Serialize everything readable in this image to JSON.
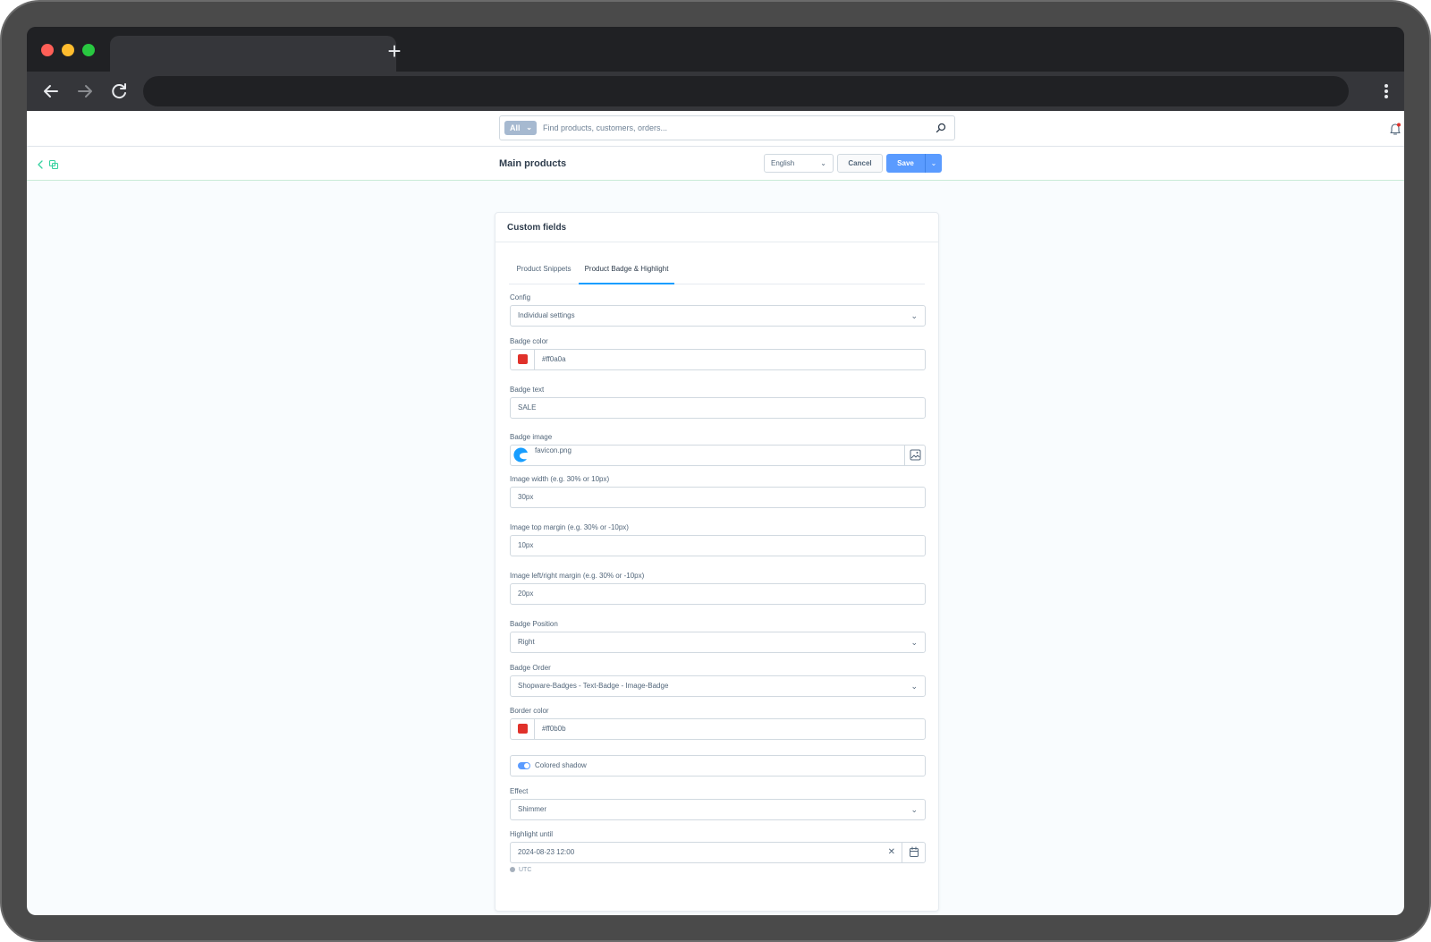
{
  "browser": {
    "new_tab_label": "+"
  },
  "search": {
    "type_label": "All",
    "placeholder": "Find products, customers, orders..."
  },
  "smartbar": {
    "title": "Main products",
    "language": "English",
    "cancel_label": "Cancel",
    "save_label": "Save"
  },
  "card": {
    "title": "Custom fields",
    "tabs": [
      {
        "label": "Product Snippets",
        "active": false
      },
      {
        "label": "Product Badge & Highlight",
        "active": true
      }
    ]
  },
  "fields": {
    "config": {
      "label": "Config",
      "value": "Individual settings"
    },
    "badge_color": {
      "label": "Badge color",
      "value": "#ff0a0a",
      "swatch": "#e0312a"
    },
    "badge_text": {
      "label": "Badge text",
      "value": "SALE"
    },
    "badge_image": {
      "label": "Badge image",
      "value": "favicon.png"
    },
    "image_width": {
      "label": "Image width (e.g. 30% or 10px)",
      "value": "30px"
    },
    "image_top_margin": {
      "label": "Image top margin (e.g. 30% or -10px)",
      "value": "10px"
    },
    "image_lr_margin": {
      "label": "Image left/right margin (e.g. 30% or -10px)",
      "value": "20px"
    },
    "badge_position": {
      "label": "Badge Position",
      "value": "Right"
    },
    "badge_order": {
      "label": "Badge Order",
      "value": "Shopware-Badges - Text-Badge - Image-Badge"
    },
    "border_color": {
      "label": "Border color",
      "value": "#ff0b0b",
      "swatch": "#e0312a"
    },
    "colored_shadow": {
      "label": "Colored shadow",
      "enabled": true
    },
    "effect": {
      "label": "Effect",
      "value": "Shimmer"
    },
    "highlight_until": {
      "label": "Highlight until",
      "value": "2024-08-23 12:00",
      "timezone": "UTC"
    }
  },
  "colors": {
    "accent": "#5a9bff",
    "active_tab": "#189eff"
  }
}
